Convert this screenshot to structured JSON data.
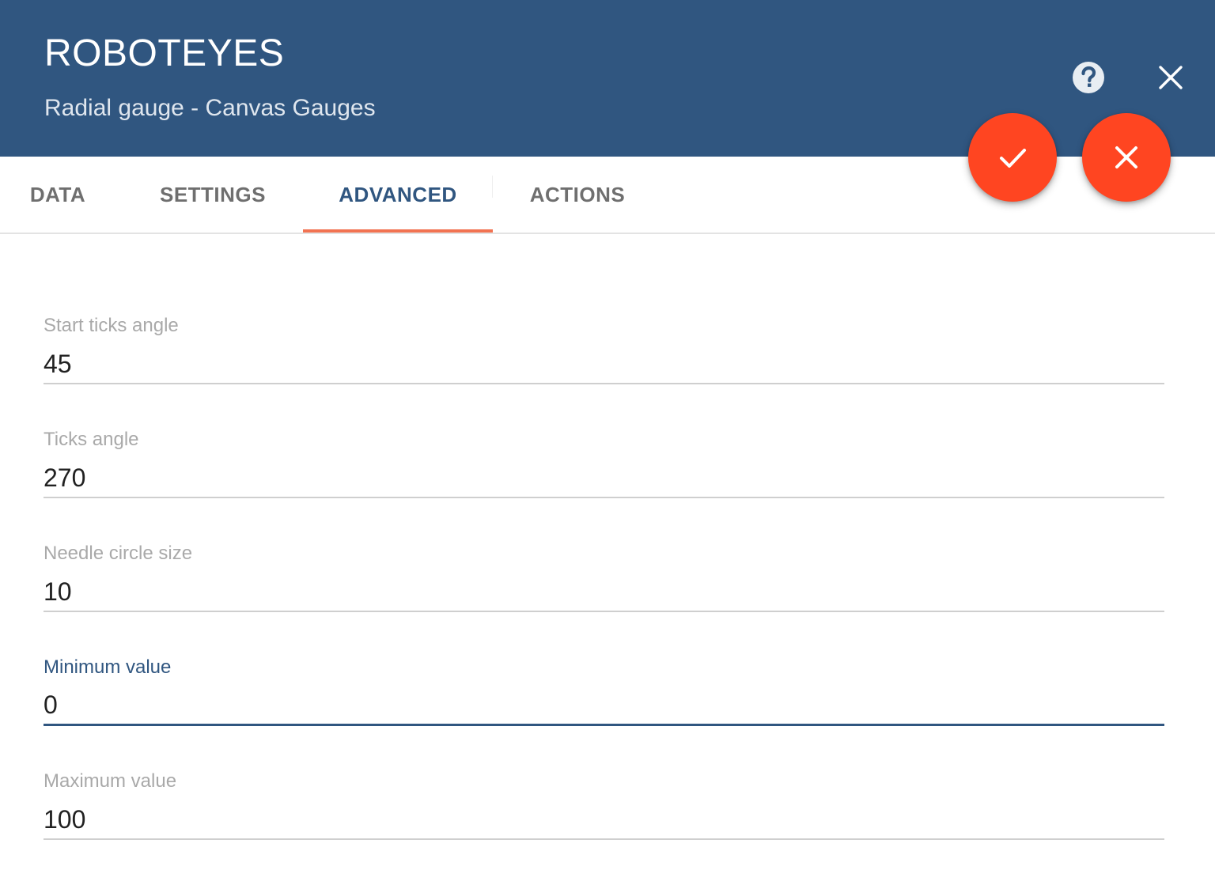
{
  "header": {
    "title": "ROBOTEYES",
    "subtitle": "Radial gauge - Canvas Gauges",
    "help_icon": "help-circle-icon",
    "close_icon": "close-icon"
  },
  "tabs": [
    {
      "label": "DATA",
      "active": false
    },
    {
      "label": "SETTINGS",
      "active": false
    },
    {
      "label": "ADVANCED",
      "active": true
    },
    {
      "label": "ACTIONS",
      "active": false
    }
  ],
  "actions": {
    "apply_icon": "check-icon",
    "discard_icon": "close-icon"
  },
  "form": {
    "fields": [
      {
        "label": "Start ticks angle",
        "value": "45"
      },
      {
        "label": "Ticks angle",
        "value": "270"
      },
      {
        "label": "Needle circle size",
        "value": "10"
      },
      {
        "label": "Minimum value",
        "value": "0",
        "focused": true
      },
      {
        "label": "Maximum value",
        "value": "100"
      }
    ]
  },
  "colors": {
    "header_bg": "#305680",
    "accent": "#305680",
    "tab_ink": "#f27352",
    "fab": "#ff4521"
  }
}
